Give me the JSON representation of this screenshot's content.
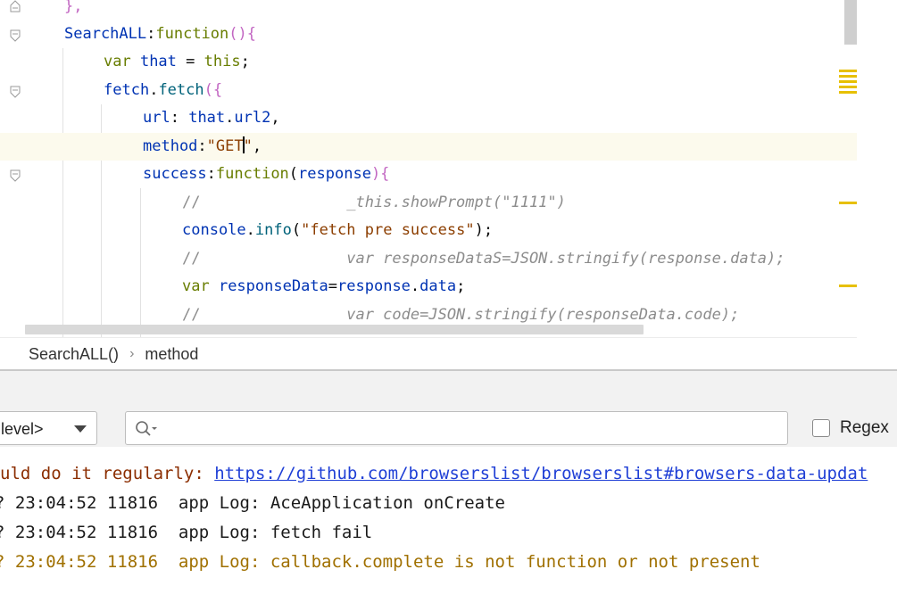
{
  "editor": {
    "lines": [
      {
        "segments": [
          {
            "t": "},",
            "c": "paren"
          }
        ]
      },
      {
        "segments": [
          {
            "t": "SearchALL",
            "c": "k"
          },
          {
            "t": ":",
            "c": "punc"
          },
          {
            "t": "function",
            "c": "kw"
          },
          {
            "t": "(){",
            "c": "paren"
          }
        ]
      },
      {
        "segments": [
          {
            "t": "var ",
            "c": "kw"
          },
          {
            "t": "that ",
            "c": "k"
          },
          {
            "t": "= ",
            "c": "punc"
          },
          {
            "t": "this",
            "c": "kw"
          },
          {
            "t": ";",
            "c": "punc"
          }
        ]
      },
      {
        "segments": [
          {
            "t": "fetch",
            "c": "k"
          },
          {
            "t": ".",
            "c": "punc"
          },
          {
            "t": "fetch",
            "c": "fn"
          },
          {
            "t": "({",
            "c": "paren"
          }
        ]
      },
      {
        "segments": [
          {
            "t": "url",
            "c": "k"
          },
          {
            "t": ": ",
            "c": "punc"
          },
          {
            "t": "that",
            "c": "k"
          },
          {
            "t": ".",
            "c": "punc"
          },
          {
            "t": "url2",
            "c": "k"
          },
          {
            "t": ",",
            "c": "punc"
          }
        ]
      },
      {
        "segments": [
          {
            "t": "method",
            "c": "k"
          },
          {
            "t": ":",
            "c": "punc"
          },
          {
            "t": "\"GET",
            "c": "strR"
          },
          {
            "t": "|caret|",
            "c": "caret"
          },
          {
            "t": "\"",
            "c": "strR"
          },
          {
            "t": ",",
            "c": "punc"
          }
        ]
      },
      {
        "segments": [
          {
            "t": "success",
            "c": "k"
          },
          {
            "t": ":",
            "c": "punc"
          },
          {
            "t": "function",
            "c": "kw"
          },
          {
            "t": "(",
            "c": "punc"
          },
          {
            "t": "response",
            "c": "k"
          },
          {
            "t": "){",
            "c": "paren"
          }
        ]
      },
      {
        "segments": [
          {
            "t": "//",
            "c": "cmtslash"
          },
          {
            "t": "                _this.showPrompt(\"1111\")",
            "c": "cmt"
          }
        ]
      },
      {
        "segments": [
          {
            "t": "console",
            "c": "k"
          },
          {
            "t": ".",
            "c": "punc"
          },
          {
            "t": "info",
            "c": "fn"
          },
          {
            "t": "(",
            "c": "punc"
          },
          {
            "t": "\"fetch pre success\"",
            "c": "strR"
          },
          {
            "t": ");",
            "c": "punc"
          }
        ]
      },
      {
        "segments": [
          {
            "t": "//",
            "c": "cmtslash"
          },
          {
            "t": "                var responseDataS=JSON.stringify(response.data);",
            "c": "cmt"
          }
        ]
      },
      {
        "segments": [
          {
            "t": "var ",
            "c": "kw"
          },
          {
            "t": "responseData",
            "c": "k"
          },
          {
            "t": "=",
            "c": "punc"
          },
          {
            "t": "response",
            "c": "k"
          },
          {
            "t": ".",
            "c": "punc"
          },
          {
            "t": "data",
            "c": "k"
          },
          {
            "t": ";",
            "c": "punc"
          }
        ]
      },
      {
        "segments": [
          {
            "t": "//",
            "c": "cmtslash"
          },
          {
            "t": "                var code=JSON.stringify(responseData.code);",
            "c": "cmt"
          }
        ]
      }
    ]
  },
  "breadcrumb": {
    "item1": "SearchALL()",
    "separator": "›",
    "item2": "method"
  },
  "logcat": {
    "level_value": "level>",
    "search_placeholder": "",
    "regex_label": "Regex",
    "line0_prefix": "uld do it regularly: ",
    "line0_link": "https://github.com/browserslist/browserslist#browsers-data-updat",
    "line1": "? 23:04:52 11816  app Log: AceApplication onCreate",
    "line2": "? 23:04:52 11816  app Log: fetch fail",
    "line3": "? 23:04:52 11816  app Log: callback.complete is not function or not present"
  },
  "colors": {
    "current_line": "#fcfaed",
    "marker": "#e7c000",
    "warn_text": "#8b2d00",
    "link": "#1f3fd6"
  }
}
